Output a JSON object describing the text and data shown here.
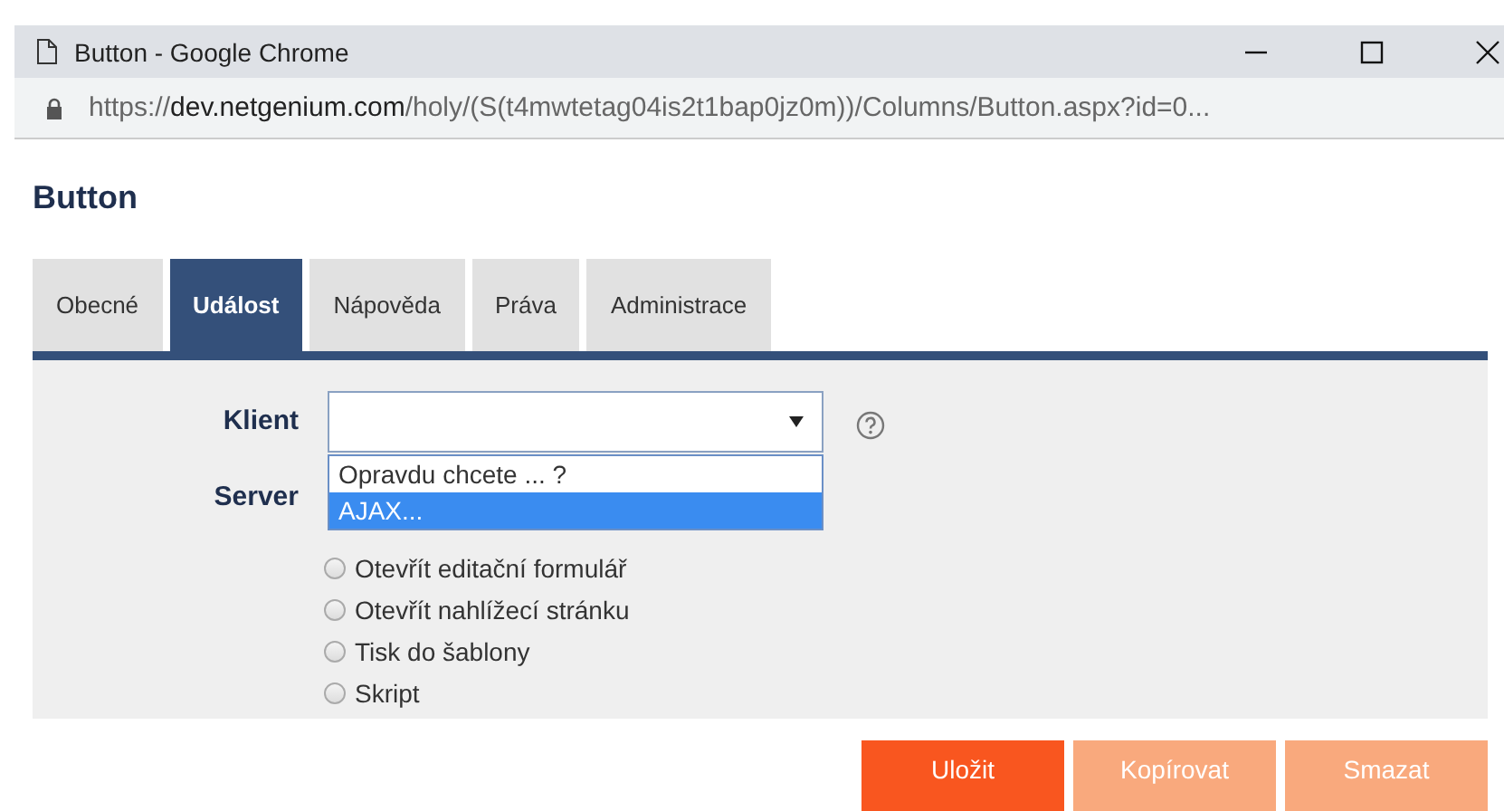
{
  "window": {
    "title": "Button - Google Chrome"
  },
  "address": {
    "scheme": "https://",
    "host": "dev.netgenium.com",
    "path": "/holy/(S(t4mwtetag04is2t1bap0jz0m))/Columns/Button.aspx?id=0..."
  },
  "heading": "Button",
  "tabs": [
    {
      "label": "Obecné",
      "selected": false
    },
    {
      "label": "Událost",
      "selected": true
    },
    {
      "label": "Nápověda",
      "selected": false
    },
    {
      "label": "Práva",
      "selected": false
    },
    {
      "label": "Administrace",
      "selected": false
    }
  ],
  "klient": {
    "label": "Klient",
    "options": [
      {
        "label": "Opravdu chcete ... ?",
        "selected": false
      },
      {
        "label": "AJAX...",
        "selected": true
      }
    ]
  },
  "server": {
    "label": "Server",
    "options": [
      {
        "label": "Otevřít editační formulář",
        "checked": false
      },
      {
        "label": "Otevřít nahlížecí stránku",
        "checked": false
      },
      {
        "label": "Tisk do šablony",
        "checked": false
      },
      {
        "label": "Skript",
        "checked": false
      }
    ]
  },
  "buttons": [
    {
      "label": "Uložit",
      "disabled": false
    },
    {
      "label": "Kopírovat",
      "disabled": true
    },
    {
      "label": "Smazat",
      "disabled": true
    }
  ]
}
